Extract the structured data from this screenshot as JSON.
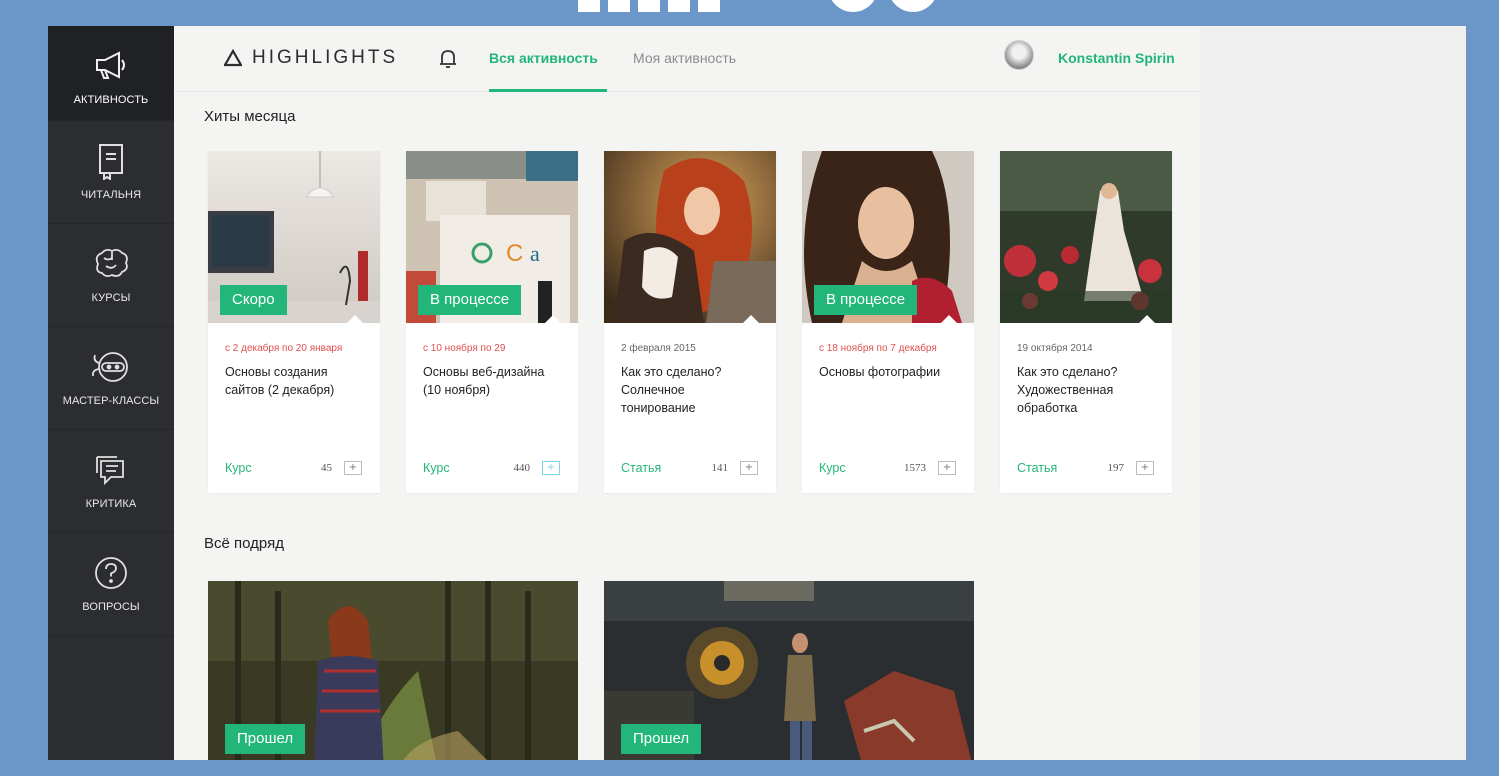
{
  "sidebar": {
    "items": [
      {
        "label": "Активность",
        "icon": "megaphone-icon"
      },
      {
        "label": "Читальня",
        "icon": "book-icon"
      },
      {
        "label": "Курсы",
        "icon": "brain-icon"
      },
      {
        "label": "Мастер-классы",
        "icon": "ninja-icon"
      },
      {
        "label": "Критика",
        "icon": "chat-icon"
      },
      {
        "label": "Вопросы",
        "icon": "question-icon"
      }
    ]
  },
  "header": {
    "logo": "HIGHLIGHTS",
    "tabs": [
      {
        "label": "Вся активность",
        "active": true
      },
      {
        "label": "Моя активность",
        "active": false
      }
    ],
    "user_name": "Konstantin Spirin"
  },
  "sections": {
    "hits_title": "Хиты месяца",
    "all_title": "Всё подряд"
  },
  "cards": [
    {
      "badge": "Скоро",
      "date": "с 2 декабря по 20 января",
      "title": "Основы создания сайтов (2 декабря)",
      "type": "Курс",
      "count": "45"
    },
    {
      "badge": "В процессе",
      "date": "с 10 ноября по 29",
      "title": "Основы веб-дизайна (10 ноября)",
      "type": "Курс",
      "count": "440"
    },
    {
      "badge": "",
      "date": "2 февраля 2015",
      "title": "Как это сделано? Солнечное тонирование",
      "type": "Статья",
      "count": "141"
    },
    {
      "badge": "В процессе",
      "date": "с 18 ноября по 7 декабря",
      "title": "Основы фотографии",
      "type": "Курс",
      "count": "1573"
    },
    {
      "badge": "",
      "date": "19 октября 2014",
      "title": "Как это сделано? Художественная обработка",
      "type": "Статья",
      "count": "197"
    }
  ],
  "big_cards": [
    {
      "badge": "Прошел"
    },
    {
      "badge": "Прошел"
    }
  ],
  "plus_symbol": "+",
  "colors": {
    "accent": "#23b67a",
    "date_red": "#e05050",
    "sidebar_bg": "#2b2d31",
    "frame_border": "#6b97c8"
  }
}
